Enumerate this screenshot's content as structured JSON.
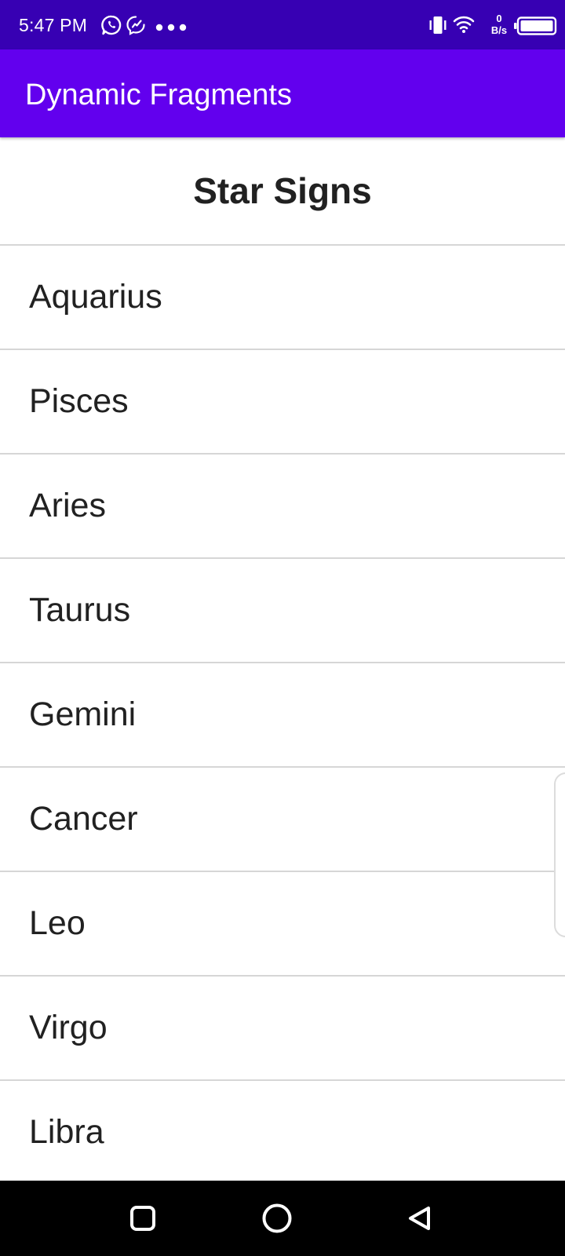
{
  "status_bar": {
    "time": "5:47 PM",
    "net_speed_value": "0",
    "net_speed_unit": "B/s",
    "icons": [
      "whatsapp-icon",
      "messenger-icon",
      "more-dots-icon",
      "vibrate-icon",
      "wifi-icon",
      "battery-icon"
    ]
  },
  "app_bar": {
    "title": "Dynamic Fragments",
    "color": "#6200ee"
  },
  "status_bar_color": "#3700b3",
  "list": {
    "heading": "Star Signs",
    "items": [
      "Aquarius",
      "Pisces",
      "Aries",
      "Taurus",
      "Gemini",
      "Cancer",
      "Leo",
      "Virgo",
      "Libra"
    ]
  },
  "nav_bar": {
    "buttons": [
      "recents-square-icon",
      "home-circle-icon",
      "back-triangle-icon"
    ]
  }
}
